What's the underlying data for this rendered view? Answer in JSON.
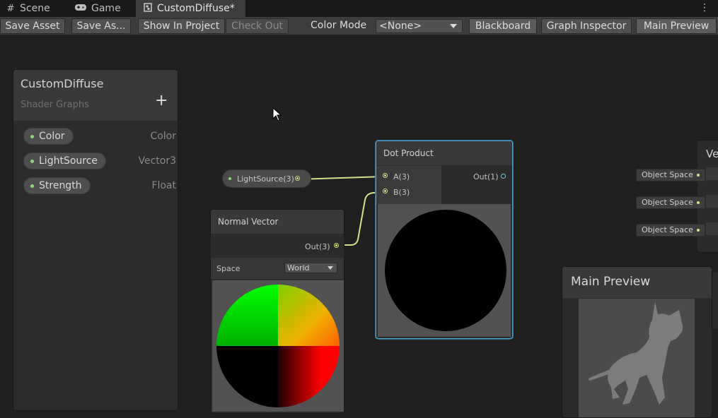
{
  "tabs": [
    {
      "label": "Scene",
      "icon": "grid-icon"
    },
    {
      "label": "Game",
      "icon": "gamepad-icon"
    },
    {
      "label": "CustomDiffuse*",
      "icon": "shader-graph-icon"
    }
  ],
  "toolbar": {
    "save_asset": "Save Asset",
    "save_as": "Save As...",
    "show_in_project": "Show In Project",
    "check_out": "Check Out",
    "color_mode_label": "Color Mode",
    "color_mode_value": "<None>",
    "blackboard": "Blackboard",
    "graph_inspector": "Graph Inspector",
    "main_preview": "Main Preview"
  },
  "blackboard": {
    "title": "CustomDiffuse",
    "subtitle": "Shader Graphs",
    "add_symbol": "+",
    "properties": [
      {
        "name": "Color",
        "type": "Color"
      },
      {
        "name": "LightSource",
        "type": "Vector3"
      },
      {
        "name": "Strength",
        "type": "Float"
      }
    ]
  },
  "graph": {
    "property_node_label": "LightSource(3)",
    "dot_product": {
      "title": "Dot Product",
      "input_a": "A(3)",
      "input_b": "B(3)",
      "output": "Out(1)"
    },
    "normal_vector": {
      "title": "Normal Vector",
      "output": "Out(3)",
      "space_label": "Space",
      "space_value": "World"
    },
    "vector_node_title_fragment": "Ve",
    "object_space_inputs": [
      "Object Space",
      "Object Space",
      "Object Space"
    ]
  },
  "main_preview": {
    "title": "Main Preview"
  },
  "colors": {
    "port_vector": "#d9e085",
    "selection": "#4aa4d8",
    "property_dot": "#8fd97c"
  }
}
